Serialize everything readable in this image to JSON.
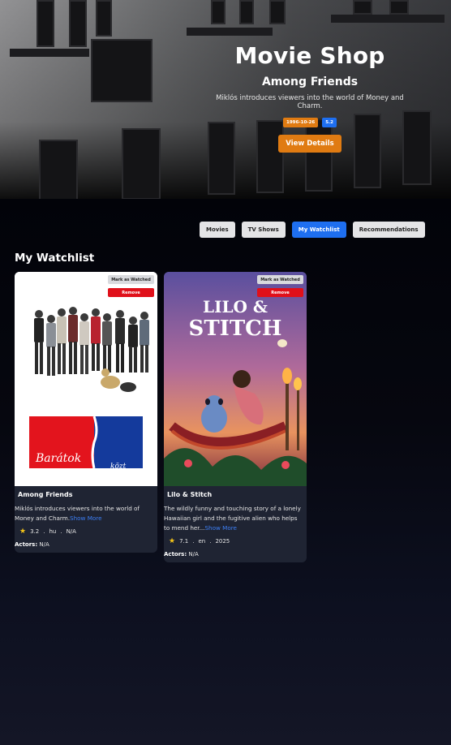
{
  "app": {
    "title": "Movie Shop"
  },
  "hero": {
    "movie_title": "Among Friends",
    "description": "Miklós introduces viewers into the world of Money and Charm.",
    "release_date": "1996-10-26",
    "rating": "5.2",
    "cta_label": "View Details",
    "accent_color": "#e07b12"
  },
  "tabs": [
    {
      "label": "Movies",
      "active": false
    },
    {
      "label": "TV Shows",
      "active": false
    },
    {
      "label": "My Watchlist",
      "active": true
    },
    {
      "label": "Recommendations",
      "active": false
    }
  ],
  "section_title": "My Watchlist",
  "watchlist": [
    {
      "title": "Among Friends",
      "description": "Miklós introduces viewers into the world of Money and Charm.",
      "show_more": "Show More",
      "rating": "3.2",
      "language": "hu",
      "year": "N/A",
      "actors_label": "Actors:",
      "actors": "N/A",
      "mark_label": "Mark as Watched",
      "remove_label": "Remove",
      "poster_text": "Barátok közt"
    },
    {
      "title": "Lilo & Stitch",
      "description": "The wildly funny and touching story of a lonely Hawaiian girl and the fugitive alien who helps to mend her...",
      "show_more": "Show More",
      "rating": "7.1",
      "language": "en",
      "year": "2025",
      "actors_label": "Actors:",
      "actors": "N/A",
      "mark_label": "Mark as Watched",
      "remove_label": "Remove",
      "poster_text": "LILO & STITCH"
    }
  ],
  "colors": {
    "primary": "#1e6ff0",
    "remove": "#e0101a",
    "card": "#1f2433"
  },
  "icons": {
    "rating": "star-icon"
  }
}
